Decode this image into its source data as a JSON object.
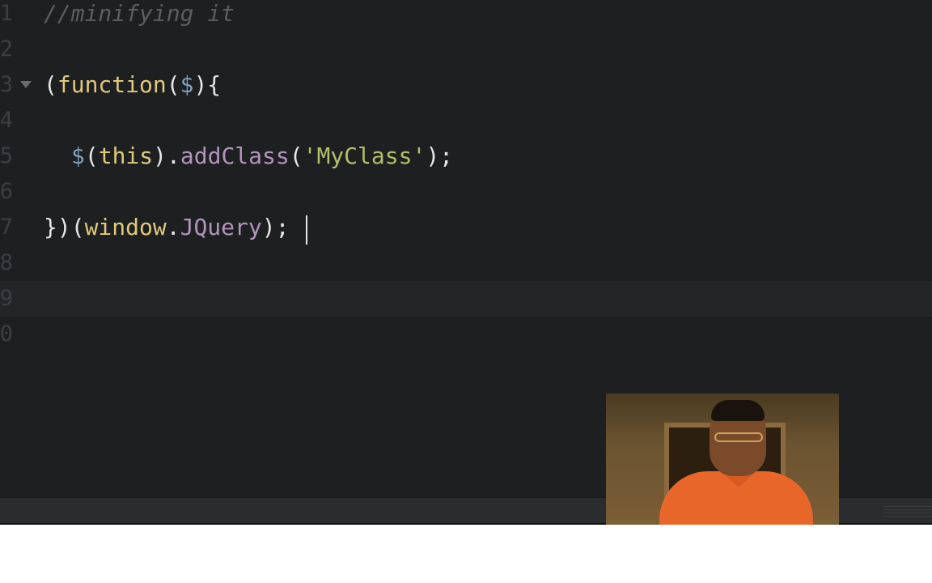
{
  "editor": {
    "lines": [
      {
        "num": "1",
        "text": "//minifying it"
      },
      {
        "num": "2",
        "text": ""
      },
      {
        "num": "3",
        "text": "(function($){"
      },
      {
        "num": "4",
        "text": ""
      },
      {
        "num": "5",
        "text": "$(this).addClass('MyClass');"
      },
      {
        "num": "6",
        "text": ""
      },
      {
        "num": "7",
        "text": "})(window.JQuery);"
      },
      {
        "num": "8",
        "text": ""
      },
      {
        "num": "9",
        "text": ""
      },
      {
        "num": "0",
        "text": ""
      }
    ],
    "tokens": {
      "l1_comment": "//minifying it",
      "l3_open": "(",
      "l3_function": "function",
      "l3_paren": "(",
      "l3_dollar": "$",
      "l3_close": "){",
      "l5_dollar": "$",
      "l5_open": "(",
      "l5_this": "this",
      "l5_close_dot": ").",
      "l5_method": "addClass",
      "l5_paren": "(",
      "l5_string": "'MyClass'",
      "l5_end": ");",
      "l7_open": "})(",
      "l7_window": "window",
      "l7_dot": ".",
      "l7_prop": "JQuery",
      "l7_end": ");"
    },
    "active_line": 9
  },
  "colors": {
    "background": "#1d1f21",
    "comment": "#5b5e61",
    "keyword": "#e0c97a",
    "function": "#b294bb",
    "string": "#b5bd68",
    "dollar": "#81a2be"
  },
  "webcam": {
    "icon": "webcam-presenter"
  }
}
